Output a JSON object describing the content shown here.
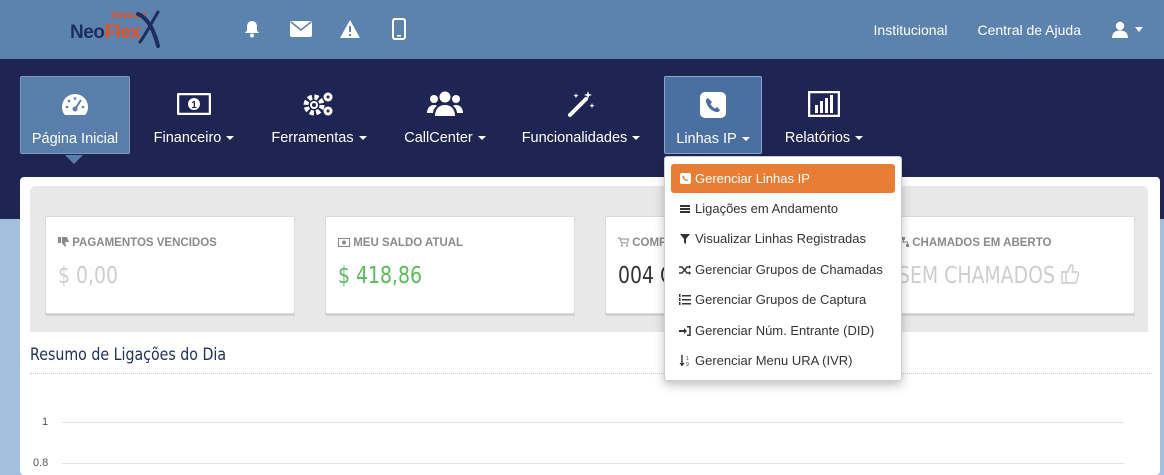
{
  "brand": {
    "top": "Telecom",
    "name_part1": "Neo",
    "name_part2": "Flex"
  },
  "top_icons": [
    "bell-icon",
    "envelope-icon",
    "warning-icon",
    "mobile-icon"
  ],
  "top_links": {
    "institucional": "Institucional",
    "ajuda": "Central de Ajuda"
  },
  "nav": {
    "items": [
      {
        "label": "Página Inicial",
        "icon": "dashboard-icon",
        "caret": false
      },
      {
        "label": "Financeiro",
        "icon": "money-icon",
        "caret": true
      },
      {
        "label": "Ferramentas",
        "icon": "gears-icon",
        "caret": true
      },
      {
        "label": "CallCenter",
        "icon": "users-icon",
        "caret": true
      },
      {
        "label": "Funcionalidades",
        "icon": "magic-wand-icon",
        "caret": true
      },
      {
        "label": "Linhas IP",
        "icon": "phone-square-icon",
        "caret": true
      },
      {
        "label": "Relatórios",
        "icon": "bar-chart-icon",
        "caret": true
      }
    ]
  },
  "dropdown": {
    "items": [
      {
        "label": "Gerenciar Linhas IP",
        "icon": "phone-square-icon"
      },
      {
        "label": "Ligações em Andamento",
        "icon": "stack-icon"
      },
      {
        "label": "Visualizar Linhas Registradas",
        "icon": "filter-icon"
      },
      {
        "label": "Gerenciar Grupos de Chamadas",
        "icon": "shuffle-icon"
      },
      {
        "label": "Gerenciar Grupos de Captura",
        "icon": "list-ol-icon"
      },
      {
        "label": "Gerenciar Núm. Entrante (DID)",
        "icon": "sign-in-icon"
      },
      {
        "label": "Gerenciar Menu URA (IVR)",
        "icon": "sort-numeric-icon"
      }
    ]
  },
  "cards": [
    {
      "title": "PAGAMENTOS VENCIDOS",
      "value": "$ 0,00",
      "icon": "thumbs-down-icon"
    },
    {
      "title": "MEU SALDO ATUAL",
      "value": "$ 418,86",
      "icon": "money-icon"
    },
    {
      "title": "COMP",
      "value": "004 C",
      "icon": "cart-icon"
    },
    {
      "title": "CHAMADOS EM ABERTO",
      "value": "SEM CHAMADOS",
      "icon": "sitemap-icon"
    }
  ],
  "section": {
    "title": "Resumo de Ligações do Dia"
  },
  "chart": {
    "y_ticks": [
      "1",
      "0.8"
    ]
  },
  "colors": {
    "topbar": "#5c82ae",
    "navbar": "#1f2553",
    "accent": "#e87d35",
    "positive": "#5cb85c"
  }
}
